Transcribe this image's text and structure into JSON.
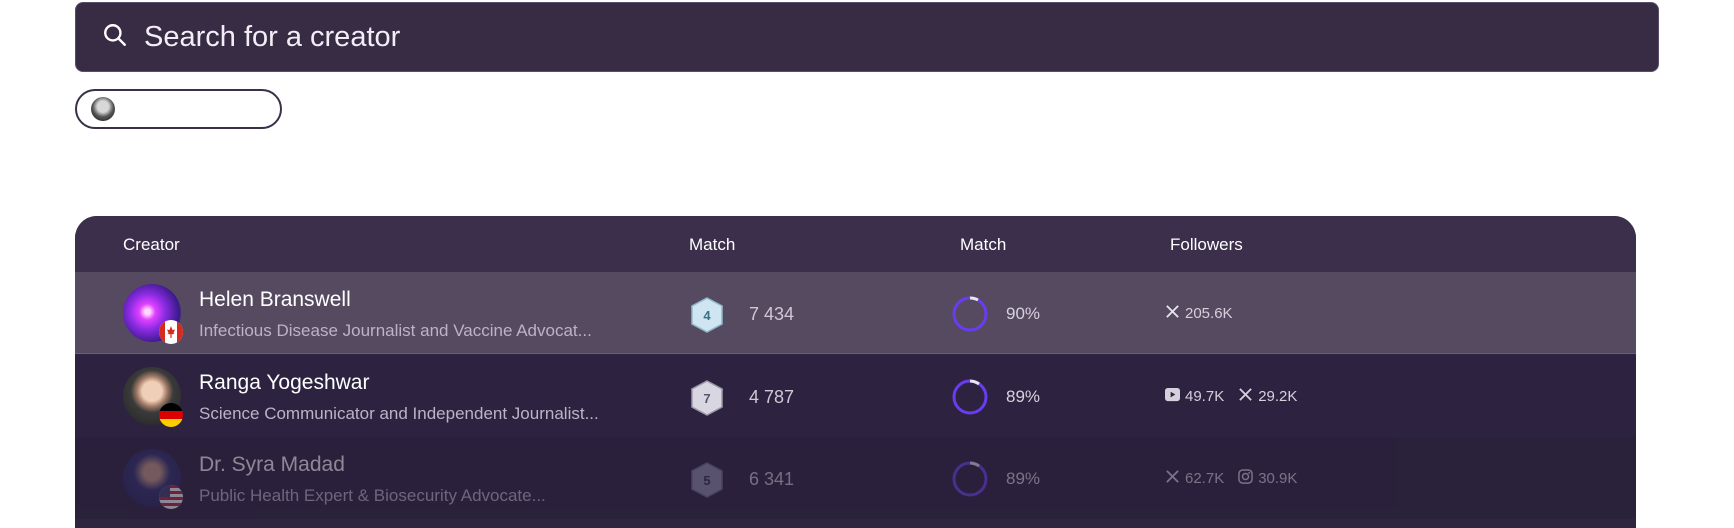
{
  "search": {
    "placeholder": "Search for a creator"
  },
  "filter_chip": {
    "label": ""
  },
  "table": {
    "columns": [
      "Creator",
      "Match",
      "Match",
      "Followers"
    ],
    "rows": [
      {
        "name": "Helen Branswell",
        "bio": "Infectious Disease Journalist and Vaccine Advocat...",
        "country": "canada-flag",
        "level": "4",
        "score": "7 434",
        "match_pct": "90%",
        "match_value": 0.9,
        "socials": [
          {
            "icon": "x-icon",
            "count": "205.6K"
          }
        ]
      },
      {
        "name": "Ranga Yogeshwar",
        "bio": "Science Communicator and Independent Journalist...",
        "country": "germany-flag",
        "level": "7",
        "score": "4 787",
        "match_pct": "89%",
        "match_value": 0.89,
        "socials": [
          {
            "icon": "youtube-icon",
            "count": "49.7K"
          },
          {
            "icon": "x-icon",
            "count": "29.2K"
          }
        ]
      },
      {
        "name": "Dr. Syra Madad",
        "bio": "Public Health Expert & Biosecurity Advocate...",
        "country": "usa-flag",
        "level": "5",
        "score": "6 341",
        "match_pct": "89%",
        "match_value": 0.89,
        "socials": [
          {
            "icon": "x-icon",
            "count": "62.7K"
          },
          {
            "icon": "instagram-icon",
            "count": "30.9K"
          }
        ]
      }
    ]
  },
  "colors": {
    "surface": "#382c45",
    "row_highlight": "#554a60",
    "match_ring": "#6a3cf0"
  }
}
